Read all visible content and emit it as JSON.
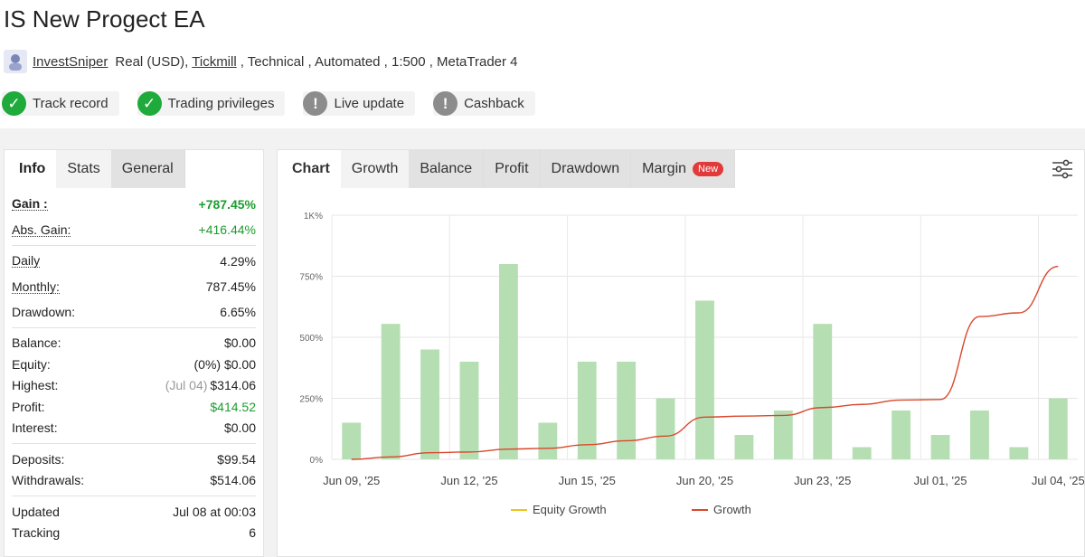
{
  "header": {
    "title": "IS New Progect EA",
    "user": "InvestSniper",
    "account": "Real (USD),",
    "broker": "Tickmill",
    "type": ", Technical , Automated , 1:500 , MetaTrader 4"
  },
  "badges": [
    {
      "label": "Track record",
      "status": "ok",
      "icon": "check-icon"
    },
    {
      "label": "Trading privileges",
      "status": "ok",
      "icon": "check-icon"
    },
    {
      "label": "Live update",
      "status": "warn",
      "icon": "exclamation-icon"
    },
    {
      "label": "Cashback",
      "status": "warn",
      "icon": "exclamation-icon"
    }
  ],
  "left_tabs": [
    "Info",
    "Stats",
    "General"
  ],
  "stats": {
    "gain": {
      "label": "Gain :",
      "value": "+787.45%"
    },
    "abs_gain": {
      "label": "Abs. Gain:",
      "value": "+416.44%"
    },
    "daily": {
      "label": "Daily",
      "value": "4.29%"
    },
    "monthly": {
      "label": "Monthly:",
      "value": "787.45%"
    },
    "drawdown": {
      "label": "Drawdown:",
      "value": "6.65%"
    },
    "balance": {
      "label": "Balance:",
      "value": "$0.00"
    },
    "equity": {
      "label": "Equity:",
      "value": "(0%) $0.00"
    },
    "highest": {
      "label": "Highest:",
      "note": "(Jul 04)",
      "value": "$314.06"
    },
    "profit": {
      "label": "Profit:",
      "value": "$414.52"
    },
    "interest": {
      "label": "Interest:",
      "value": "$0.00"
    },
    "deposits": {
      "label": "Deposits:",
      "value": "$99.54"
    },
    "withdrawals": {
      "label": "Withdrawals:",
      "value": "$514.06"
    },
    "updated": {
      "label": "Updated",
      "value": "Jul 08 at 00:03"
    },
    "tracking": {
      "label": "Tracking",
      "value": "6"
    }
  },
  "chart_tabs": {
    "heading": "Chart",
    "items": [
      "Growth",
      "Balance",
      "Profit",
      "Drawdown",
      "Margin"
    ],
    "active": "Growth",
    "new_badge": "New"
  },
  "colors": {
    "bar": "#b5dfb3",
    "growth_line": "#d9472b",
    "equity_line": "#f0c419",
    "green_value": "#1b9e2f",
    "ok_badge": "#1faa3c",
    "warn_badge": "#8c8c8c"
  },
  "chart_data": {
    "type": "bar",
    "yticks": [
      "0%",
      "250%",
      "500%",
      "750%",
      "1K%"
    ],
    "ylim": [
      0,
      1000
    ],
    "xticks": [
      "Jun 09, '25",
      "Jun 12, '25",
      "Jun 15, '25",
      "Jun 20, '25",
      "Jun 23, '25",
      "Jul 01, '25",
      "Jul 04, '25"
    ],
    "bars": [
      150,
      555,
      450,
      400,
      800,
      150,
      400,
      400,
      250,
      650,
      100,
      200,
      555,
      50,
      200,
      100,
      200,
      50,
      250
    ],
    "growth": {
      "name": "Growth",
      "x": [
        0,
        1,
        2,
        3,
        4,
        5,
        6,
        7,
        8,
        9,
        10,
        11,
        12,
        13,
        14,
        15,
        16,
        17,
        18
      ],
      "y": [
        0,
        10,
        27,
        30,
        42,
        45,
        60,
        76,
        95,
        173,
        177,
        180,
        212,
        225,
        243,
        245,
        585,
        600,
        790
      ]
    },
    "legend": [
      "Equity Growth",
      "Growth"
    ]
  }
}
